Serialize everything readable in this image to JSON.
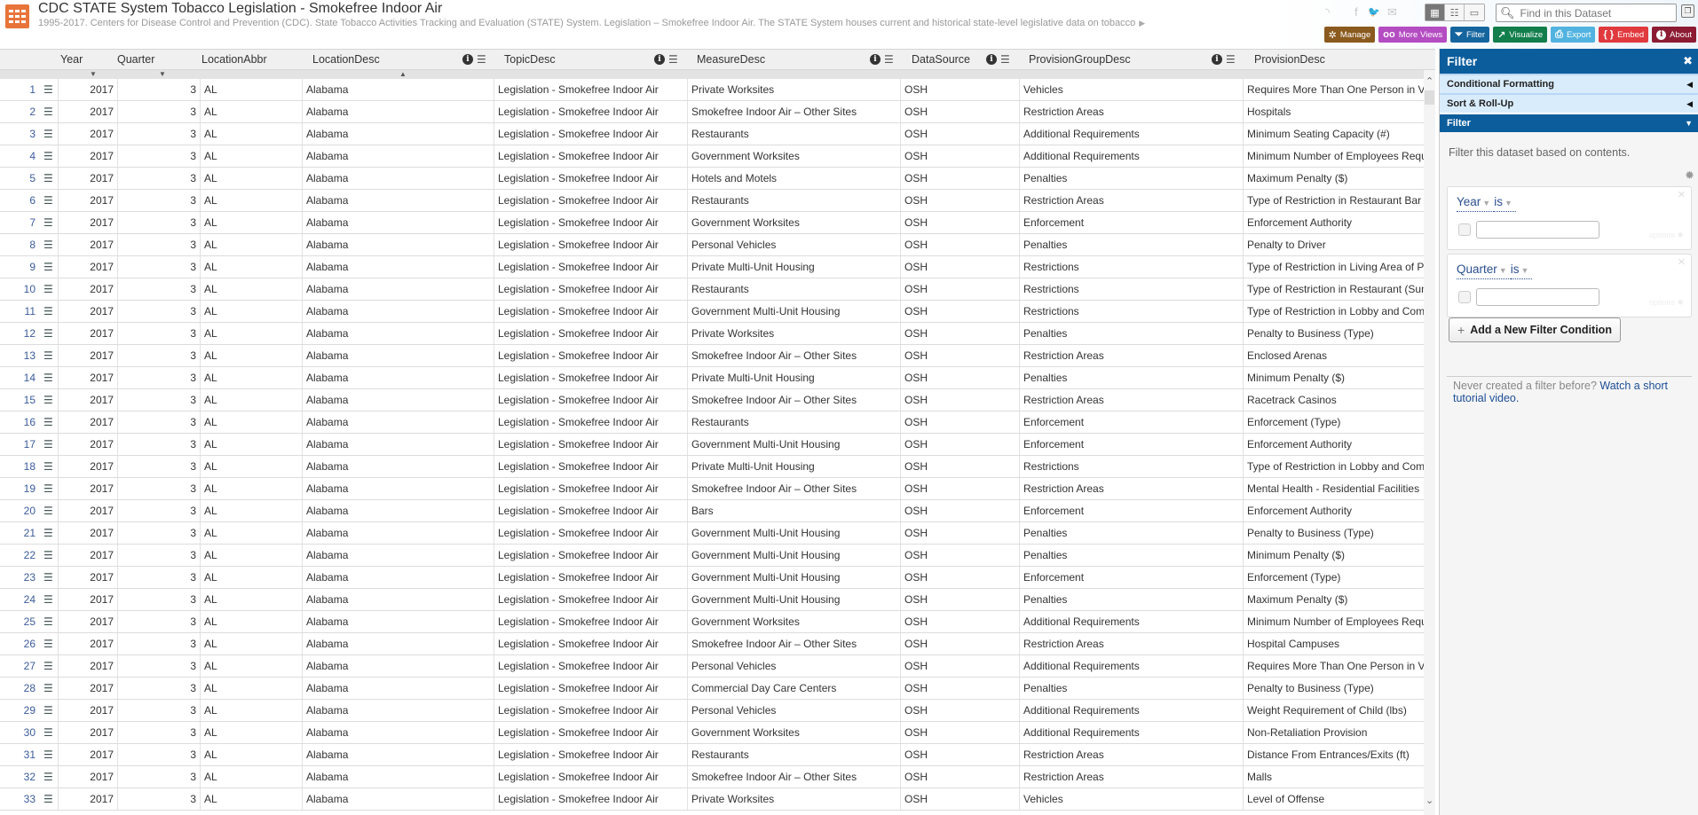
{
  "header": {
    "title": "CDC STATE System Tobacco Legislation - Smokefree Indoor Air",
    "subtitle": "1995-2017. Centers for Disease Control and Prevention (CDC). State Tobacco Activities Tracking and Evaluation (STATE) System. Legislation – Smokefree Indoor Air. The STATE System houses current and historical state-level legislative data on tobacco",
    "more_icon": "▶",
    "social": [
      {
        "name": "rss-icon",
        "glyph": "◝"
      },
      {
        "name": "facebook-icon",
        "glyph": "f"
      },
      {
        "name": "twitter-icon",
        "glyph": "🐦"
      },
      {
        "name": "email-icon",
        "glyph": "✉"
      }
    ],
    "views": [
      {
        "name": "grid-view",
        "glyph": "▦",
        "active": true
      },
      {
        "name": "list-view",
        "glyph": "☷",
        "active": false
      },
      {
        "name": "page-view",
        "glyph": "▭",
        "active": false
      }
    ],
    "search_placeholder": "Find in this Dataset",
    "toolbar": [
      {
        "id": "manage",
        "label": "Manage",
        "icon": "✲",
        "color": "#8a5a1e"
      },
      {
        "id": "more-views",
        "label": "More Views",
        "icon": "oo",
        "color": "#b44cc2"
      },
      {
        "id": "filter",
        "label": "Filter",
        "icon": "⏷",
        "color": "#14649e"
      },
      {
        "id": "visualize",
        "label": "Visualize",
        "icon": "↗",
        "color": "#127e4c"
      },
      {
        "id": "export",
        "label": "Export",
        "icon": "⎙",
        "color": "#52b3e0"
      },
      {
        "id": "embed",
        "label": "Embed",
        "icon": "{ }",
        "color": "#e0393e"
      },
      {
        "id": "about",
        "label": "About",
        "icon": "i",
        "color": "#8c1b33"
      }
    ]
  },
  "columns": [
    {
      "key": "Year",
      "label": "Year",
      "sort": "desc",
      "icons": false
    },
    {
      "key": "Quarter",
      "label": "Quarter",
      "sort": "desc",
      "icons": false
    },
    {
      "key": "LocationAbbr",
      "label": "LocationAbbr",
      "sort": "",
      "icons": false
    },
    {
      "key": "LocationDesc",
      "label": "LocationDesc",
      "sort": "asc",
      "icons": true
    },
    {
      "key": "TopicDesc",
      "label": "TopicDesc",
      "sort": "",
      "icons": true
    },
    {
      "key": "MeasureDesc",
      "label": "MeasureDesc",
      "sort": "",
      "icons": true
    },
    {
      "key": "DataSource",
      "label": "DataSource",
      "sort": "",
      "icons": true
    },
    {
      "key": "ProvisionGroupDesc",
      "label": "ProvisionGroupDesc",
      "sort": "",
      "icons": true
    },
    {
      "key": "ProvisionDesc",
      "label": "ProvisionDesc",
      "sort": "",
      "icons": false
    }
  ],
  "rows": [
    {
      "n": "1",
      "y": "2017",
      "q": "3",
      "abbr": "AL",
      "loc": "Alabama",
      "topic": "Legislation - Smokefree Indoor Air",
      "measure": "Private Worksites",
      "src": "OSH",
      "group": "Vehicles",
      "prov": "Requires More Than One Person in Vehicle"
    },
    {
      "n": "2",
      "y": "2017",
      "q": "3",
      "abbr": "AL",
      "loc": "Alabama",
      "topic": "Legislation - Smokefree Indoor Air",
      "measure": "Smokefree Indoor Air – Other Sites",
      "src": "OSH",
      "group": "Restriction Areas",
      "prov": "Hospitals"
    },
    {
      "n": "3",
      "y": "2017",
      "q": "3",
      "abbr": "AL",
      "loc": "Alabama",
      "topic": "Legislation - Smokefree Indoor Air",
      "measure": "Restaurants",
      "src": "OSH",
      "group": "Additional Requirements",
      "prov": "Minimum Seating Capacity (#)"
    },
    {
      "n": "4",
      "y": "2017",
      "q": "3",
      "abbr": "AL",
      "loc": "Alabama",
      "topic": "Legislation - Smokefree Indoor Air",
      "measure": "Government Worksites",
      "src": "OSH",
      "group": "Additional Requirements",
      "prov": "Minimum Number of Employees Required"
    },
    {
      "n": "5",
      "y": "2017",
      "q": "3",
      "abbr": "AL",
      "loc": "Alabama",
      "topic": "Legislation - Smokefree Indoor Air",
      "measure": "Hotels and Motels",
      "src": "OSH",
      "group": "Penalties",
      "prov": "Maximum Penalty ($)"
    },
    {
      "n": "6",
      "y": "2017",
      "q": "3",
      "abbr": "AL",
      "loc": "Alabama",
      "topic": "Legislation - Smokefree Indoor Air",
      "measure": "Restaurants",
      "src": "OSH",
      "group": "Restriction Areas",
      "prov": "Type of Restriction in Restaurant Bar Area"
    },
    {
      "n": "7",
      "y": "2017",
      "q": "3",
      "abbr": "AL",
      "loc": "Alabama",
      "topic": "Legislation - Smokefree Indoor Air",
      "measure": "Government Worksites",
      "src": "OSH",
      "group": "Enforcement",
      "prov": "Enforcement Authority"
    },
    {
      "n": "8",
      "y": "2017",
      "q": "3",
      "abbr": "AL",
      "loc": "Alabama",
      "topic": "Legislation - Smokefree Indoor Air",
      "measure": "Personal Vehicles",
      "src": "OSH",
      "group": "Penalties",
      "prov": "Penalty to Driver"
    },
    {
      "n": "9",
      "y": "2017",
      "q": "3",
      "abbr": "AL",
      "loc": "Alabama",
      "topic": "Legislation - Smokefree Indoor Air",
      "measure": "Private Multi-Unit Housing",
      "src": "OSH",
      "group": "Restrictions",
      "prov": "Type of Restriction in Living Area of Private Units"
    },
    {
      "n": "10",
      "y": "2017",
      "q": "3",
      "abbr": "AL",
      "loc": "Alabama",
      "topic": "Legislation - Smokefree Indoor Air",
      "measure": "Restaurants",
      "src": "OSH",
      "group": "Restrictions",
      "prov": "Type of Restriction in Restaurant (Summary)"
    },
    {
      "n": "11",
      "y": "2017",
      "q": "3",
      "abbr": "AL",
      "loc": "Alabama",
      "topic": "Legislation - Smokefree Indoor Air",
      "measure": "Government Multi-Unit Housing",
      "src": "OSH",
      "group": "Restrictions",
      "prov": "Type of Restriction in Lobby and Common Areas"
    },
    {
      "n": "12",
      "y": "2017",
      "q": "3",
      "abbr": "AL",
      "loc": "Alabama",
      "topic": "Legislation - Smokefree Indoor Air",
      "measure": "Private Worksites",
      "src": "OSH",
      "group": "Penalties",
      "prov": "Penalty to Business (Type)"
    },
    {
      "n": "13",
      "y": "2017",
      "q": "3",
      "abbr": "AL",
      "loc": "Alabama",
      "topic": "Legislation - Smokefree Indoor Air",
      "measure": "Smokefree Indoor Air – Other Sites",
      "src": "OSH",
      "group": "Restriction Areas",
      "prov": "Enclosed Arenas"
    },
    {
      "n": "14",
      "y": "2017",
      "q": "3",
      "abbr": "AL",
      "loc": "Alabama",
      "topic": "Legislation - Smokefree Indoor Air",
      "measure": "Private Multi-Unit Housing",
      "src": "OSH",
      "group": "Penalties",
      "prov": "Minimum Penalty ($)"
    },
    {
      "n": "15",
      "y": "2017",
      "q": "3",
      "abbr": "AL",
      "loc": "Alabama",
      "topic": "Legislation - Smokefree Indoor Air",
      "measure": "Smokefree Indoor Air – Other Sites",
      "src": "OSH",
      "group": "Restriction Areas",
      "prov": "Racetrack Casinos"
    },
    {
      "n": "16",
      "y": "2017",
      "q": "3",
      "abbr": "AL",
      "loc": "Alabama",
      "topic": "Legislation - Smokefree Indoor Air",
      "measure": "Restaurants",
      "src": "OSH",
      "group": "Enforcement",
      "prov": "Enforcement (Type)"
    },
    {
      "n": "17",
      "y": "2017",
      "q": "3",
      "abbr": "AL",
      "loc": "Alabama",
      "topic": "Legislation - Smokefree Indoor Air",
      "measure": "Government Multi-Unit Housing",
      "src": "OSH",
      "group": "Enforcement",
      "prov": "Enforcement Authority"
    },
    {
      "n": "18",
      "y": "2017",
      "q": "3",
      "abbr": "AL",
      "loc": "Alabama",
      "topic": "Legislation - Smokefree Indoor Air",
      "measure": "Private Multi-Unit Housing",
      "src": "OSH",
      "group": "Restrictions",
      "prov": "Type of Restriction in Lobby and Common Areas"
    },
    {
      "n": "19",
      "y": "2017",
      "q": "3",
      "abbr": "AL",
      "loc": "Alabama",
      "topic": "Legislation - Smokefree Indoor Air",
      "measure": "Smokefree Indoor Air – Other Sites",
      "src": "OSH",
      "group": "Restriction Areas",
      "prov": "Mental Health - Residential Facilities"
    },
    {
      "n": "20",
      "y": "2017",
      "q": "3",
      "abbr": "AL",
      "loc": "Alabama",
      "topic": "Legislation - Smokefree Indoor Air",
      "measure": "Bars",
      "src": "OSH",
      "group": "Enforcement",
      "prov": "Enforcement Authority"
    },
    {
      "n": "21",
      "y": "2017",
      "q": "3",
      "abbr": "AL",
      "loc": "Alabama",
      "topic": "Legislation - Smokefree Indoor Air",
      "measure": "Government Multi-Unit Housing",
      "src": "OSH",
      "group": "Penalties",
      "prov": "Penalty to Business (Type)"
    },
    {
      "n": "22",
      "y": "2017",
      "q": "3",
      "abbr": "AL",
      "loc": "Alabama",
      "topic": "Legislation - Smokefree Indoor Air",
      "measure": "Government Multi-Unit Housing",
      "src": "OSH",
      "group": "Penalties",
      "prov": "Minimum Penalty ($)"
    },
    {
      "n": "23",
      "y": "2017",
      "q": "3",
      "abbr": "AL",
      "loc": "Alabama",
      "topic": "Legislation - Smokefree Indoor Air",
      "measure": "Government Multi-Unit Housing",
      "src": "OSH",
      "group": "Enforcement",
      "prov": "Enforcement (Type)"
    },
    {
      "n": "24",
      "y": "2017",
      "q": "3",
      "abbr": "AL",
      "loc": "Alabama",
      "topic": "Legislation - Smokefree Indoor Air",
      "measure": "Government Multi-Unit Housing",
      "src": "OSH",
      "group": "Penalties",
      "prov": "Maximum Penalty ($)"
    },
    {
      "n": "25",
      "y": "2017",
      "q": "3",
      "abbr": "AL",
      "loc": "Alabama",
      "topic": "Legislation - Smokefree Indoor Air",
      "measure": "Government Worksites",
      "src": "OSH",
      "group": "Additional Requirements",
      "prov": "Minimum Number of Employees Required"
    },
    {
      "n": "26",
      "y": "2017",
      "q": "3",
      "abbr": "AL",
      "loc": "Alabama",
      "topic": "Legislation - Smokefree Indoor Air",
      "measure": "Smokefree Indoor Air – Other Sites",
      "src": "OSH",
      "group": "Restriction Areas",
      "prov": "Hospital Campuses"
    },
    {
      "n": "27",
      "y": "2017",
      "q": "3",
      "abbr": "AL",
      "loc": "Alabama",
      "topic": "Legislation - Smokefree Indoor Air",
      "measure": "Personal Vehicles",
      "src": "OSH",
      "group": "Additional Requirements",
      "prov": "Requires More Than One Person in Vehicle"
    },
    {
      "n": "28",
      "y": "2017",
      "q": "3",
      "abbr": "AL",
      "loc": "Alabama",
      "topic": "Legislation - Smokefree Indoor Air",
      "measure": "Commercial Day Care Centers",
      "src": "OSH",
      "group": "Penalties",
      "prov": "Penalty to Business (Type)"
    },
    {
      "n": "29",
      "y": "2017",
      "q": "3",
      "abbr": "AL",
      "loc": "Alabama",
      "topic": "Legislation - Smokefree Indoor Air",
      "measure": "Personal Vehicles",
      "src": "OSH",
      "group": "Additional Requirements",
      "prov": "Weight Requirement of Child (lbs)"
    },
    {
      "n": "30",
      "y": "2017",
      "q": "3",
      "abbr": "AL",
      "loc": "Alabama",
      "topic": "Legislation - Smokefree Indoor Air",
      "measure": "Government Worksites",
      "src": "OSH",
      "group": "Additional Requirements",
      "prov": "Non-Retaliation Provision"
    },
    {
      "n": "31",
      "y": "2017",
      "q": "3",
      "abbr": "AL",
      "loc": "Alabama",
      "topic": "Legislation - Smokefree Indoor Air",
      "measure": "Restaurants",
      "src": "OSH",
      "group": "Restriction Areas",
      "prov": "Distance From Entrances/Exits (ft)"
    },
    {
      "n": "32",
      "y": "2017",
      "q": "3",
      "abbr": "AL",
      "loc": "Alabama",
      "topic": "Legislation - Smokefree Indoor Air",
      "measure": "Smokefree Indoor Air – Other Sites",
      "src": "OSH",
      "group": "Restriction Areas",
      "prov": "Malls"
    },
    {
      "n": "33",
      "y": "2017",
      "q": "3",
      "abbr": "AL",
      "loc": "Alabama",
      "topic": "Legislation - Smokefree Indoor Air",
      "measure": "Private Worksites",
      "src": "OSH",
      "group": "Vehicles",
      "prov": "Level of Offense"
    }
  ],
  "panel": {
    "title": "Filter",
    "close_icon": "✖",
    "sections": [
      {
        "label": "Conditional Formatting",
        "icon": "◀",
        "active": false
      },
      {
        "label": "Sort & Roll-Up",
        "icon": "◀",
        "active": false
      },
      {
        "label": "Filter",
        "icon": "▼",
        "active": true
      }
    ],
    "description": "Filter this dataset based on contents.",
    "conditions": [
      {
        "field": "Year",
        "operator": "is",
        "value": "",
        "options_label": "options"
      },
      {
        "field": "Quarter",
        "operator": "is",
        "value": "",
        "options_label": "options"
      }
    ],
    "add_condition_label": "Add a New Filter Condition",
    "help_text": "Never created a filter before?",
    "help_link": "Watch a short tutorial video."
  }
}
